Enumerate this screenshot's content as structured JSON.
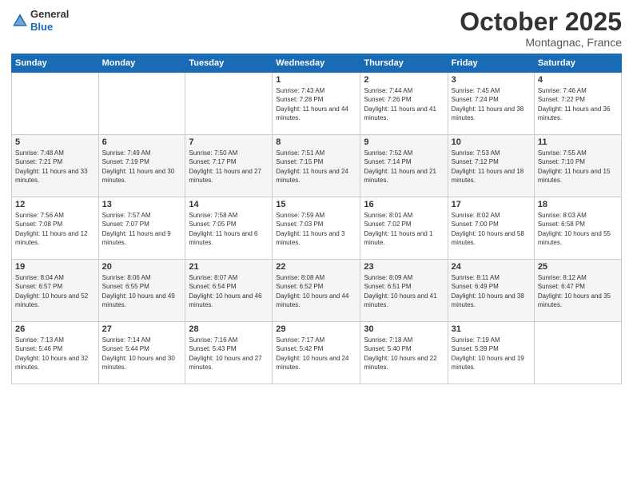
{
  "header": {
    "logo": {
      "general": "General",
      "blue": "Blue"
    },
    "title": "October 2025",
    "subtitle": "Montagnac, France"
  },
  "days_of_week": [
    "Sunday",
    "Monday",
    "Tuesday",
    "Wednesday",
    "Thursday",
    "Friday",
    "Saturday"
  ],
  "weeks": [
    [
      {
        "day": "",
        "sunrise": "",
        "sunset": "",
        "daylight": ""
      },
      {
        "day": "",
        "sunrise": "",
        "sunset": "",
        "daylight": ""
      },
      {
        "day": "",
        "sunrise": "",
        "sunset": "",
        "daylight": ""
      },
      {
        "day": "1",
        "sunrise": "Sunrise: 7:43 AM",
        "sunset": "Sunset: 7:28 PM",
        "daylight": "Daylight: 11 hours and 44 minutes."
      },
      {
        "day": "2",
        "sunrise": "Sunrise: 7:44 AM",
        "sunset": "Sunset: 7:26 PM",
        "daylight": "Daylight: 11 hours and 41 minutes."
      },
      {
        "day": "3",
        "sunrise": "Sunrise: 7:45 AM",
        "sunset": "Sunset: 7:24 PM",
        "daylight": "Daylight: 11 hours and 38 minutes."
      },
      {
        "day": "4",
        "sunrise": "Sunrise: 7:46 AM",
        "sunset": "Sunset: 7:22 PM",
        "daylight": "Daylight: 11 hours and 36 minutes."
      }
    ],
    [
      {
        "day": "5",
        "sunrise": "Sunrise: 7:48 AM",
        "sunset": "Sunset: 7:21 PM",
        "daylight": "Daylight: 11 hours and 33 minutes."
      },
      {
        "day": "6",
        "sunrise": "Sunrise: 7:49 AM",
        "sunset": "Sunset: 7:19 PM",
        "daylight": "Daylight: 11 hours and 30 minutes."
      },
      {
        "day": "7",
        "sunrise": "Sunrise: 7:50 AM",
        "sunset": "Sunset: 7:17 PM",
        "daylight": "Daylight: 11 hours and 27 minutes."
      },
      {
        "day": "8",
        "sunrise": "Sunrise: 7:51 AM",
        "sunset": "Sunset: 7:15 PM",
        "daylight": "Daylight: 11 hours and 24 minutes."
      },
      {
        "day": "9",
        "sunrise": "Sunrise: 7:52 AM",
        "sunset": "Sunset: 7:14 PM",
        "daylight": "Daylight: 11 hours and 21 minutes."
      },
      {
        "day": "10",
        "sunrise": "Sunrise: 7:53 AM",
        "sunset": "Sunset: 7:12 PM",
        "daylight": "Daylight: 11 hours and 18 minutes."
      },
      {
        "day": "11",
        "sunrise": "Sunrise: 7:55 AM",
        "sunset": "Sunset: 7:10 PM",
        "daylight": "Daylight: 11 hours and 15 minutes."
      }
    ],
    [
      {
        "day": "12",
        "sunrise": "Sunrise: 7:56 AM",
        "sunset": "Sunset: 7:08 PM",
        "daylight": "Daylight: 11 hours and 12 minutes."
      },
      {
        "day": "13",
        "sunrise": "Sunrise: 7:57 AM",
        "sunset": "Sunset: 7:07 PM",
        "daylight": "Daylight: 11 hours and 9 minutes."
      },
      {
        "day": "14",
        "sunrise": "Sunrise: 7:58 AM",
        "sunset": "Sunset: 7:05 PM",
        "daylight": "Daylight: 11 hours and 6 minutes."
      },
      {
        "day": "15",
        "sunrise": "Sunrise: 7:59 AM",
        "sunset": "Sunset: 7:03 PM",
        "daylight": "Daylight: 11 hours and 3 minutes."
      },
      {
        "day": "16",
        "sunrise": "Sunrise: 8:01 AM",
        "sunset": "Sunset: 7:02 PM",
        "daylight": "Daylight: 11 hours and 1 minute."
      },
      {
        "day": "17",
        "sunrise": "Sunrise: 8:02 AM",
        "sunset": "Sunset: 7:00 PM",
        "daylight": "Daylight: 10 hours and 58 minutes."
      },
      {
        "day": "18",
        "sunrise": "Sunrise: 8:03 AM",
        "sunset": "Sunset: 6:58 PM",
        "daylight": "Daylight: 10 hours and 55 minutes."
      }
    ],
    [
      {
        "day": "19",
        "sunrise": "Sunrise: 8:04 AM",
        "sunset": "Sunset: 6:57 PM",
        "daylight": "Daylight: 10 hours and 52 minutes."
      },
      {
        "day": "20",
        "sunrise": "Sunrise: 8:06 AM",
        "sunset": "Sunset: 6:55 PM",
        "daylight": "Daylight: 10 hours and 49 minutes."
      },
      {
        "day": "21",
        "sunrise": "Sunrise: 8:07 AM",
        "sunset": "Sunset: 6:54 PM",
        "daylight": "Daylight: 10 hours and 46 minutes."
      },
      {
        "day": "22",
        "sunrise": "Sunrise: 8:08 AM",
        "sunset": "Sunset: 6:52 PM",
        "daylight": "Daylight: 10 hours and 44 minutes."
      },
      {
        "day": "23",
        "sunrise": "Sunrise: 8:09 AM",
        "sunset": "Sunset: 6:51 PM",
        "daylight": "Daylight: 10 hours and 41 minutes."
      },
      {
        "day": "24",
        "sunrise": "Sunrise: 8:11 AM",
        "sunset": "Sunset: 6:49 PM",
        "daylight": "Daylight: 10 hours and 38 minutes."
      },
      {
        "day": "25",
        "sunrise": "Sunrise: 8:12 AM",
        "sunset": "Sunset: 6:47 PM",
        "daylight": "Daylight: 10 hours and 35 minutes."
      }
    ],
    [
      {
        "day": "26",
        "sunrise": "Sunrise: 7:13 AM",
        "sunset": "Sunset: 5:46 PM",
        "daylight": "Daylight: 10 hours and 32 minutes."
      },
      {
        "day": "27",
        "sunrise": "Sunrise: 7:14 AM",
        "sunset": "Sunset: 5:44 PM",
        "daylight": "Daylight: 10 hours and 30 minutes."
      },
      {
        "day": "28",
        "sunrise": "Sunrise: 7:16 AM",
        "sunset": "Sunset: 5:43 PM",
        "daylight": "Daylight: 10 hours and 27 minutes."
      },
      {
        "day": "29",
        "sunrise": "Sunrise: 7:17 AM",
        "sunset": "Sunset: 5:42 PM",
        "daylight": "Daylight: 10 hours and 24 minutes."
      },
      {
        "day": "30",
        "sunrise": "Sunrise: 7:18 AM",
        "sunset": "Sunset: 5:40 PM",
        "daylight": "Daylight: 10 hours and 22 minutes."
      },
      {
        "day": "31",
        "sunrise": "Sunrise: 7:19 AM",
        "sunset": "Sunset: 5:39 PM",
        "daylight": "Daylight: 10 hours and 19 minutes."
      },
      {
        "day": "",
        "sunrise": "",
        "sunset": "",
        "daylight": ""
      }
    ]
  ]
}
